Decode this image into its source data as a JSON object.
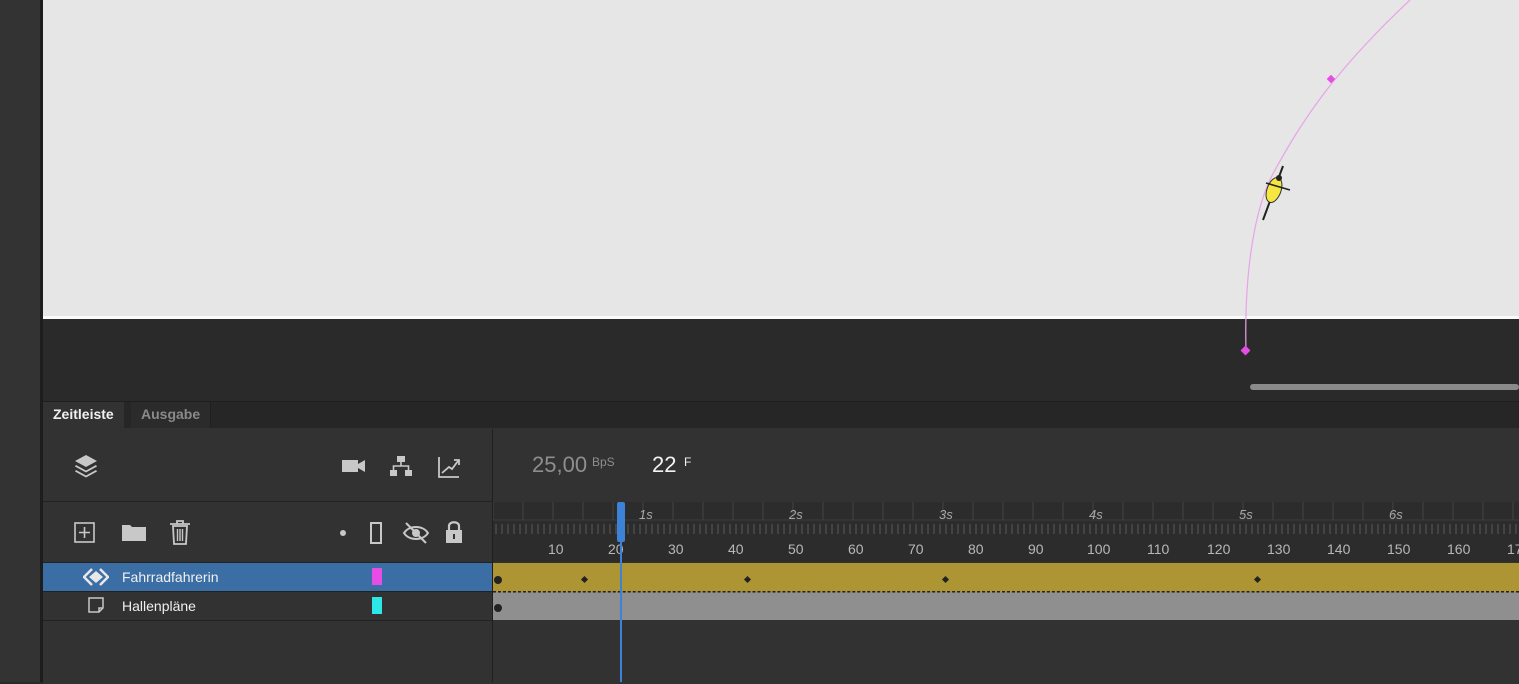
{
  "tabs": {
    "timeline": "Zeitleiste",
    "output": "Ausgabe"
  },
  "timeline": {
    "fps_value": "25,00",
    "fps_unit": "BpS",
    "current_frame": "22",
    "frame_unit": "F",
    "second_labels": [
      "1s",
      "2s",
      "3s",
      "4s",
      "5s",
      "6s"
    ],
    "frame_labels": [
      "10",
      "20",
      "30",
      "40",
      "50",
      "60",
      "70",
      "80",
      "90",
      "100",
      "110",
      "120",
      "130",
      "140",
      "150",
      "160",
      "17"
    ]
  },
  "layers": [
    {
      "name": "Fahrradfahrerin",
      "color": "#e64ce6",
      "selected": true,
      "icon": "motion-tween-icon"
    },
    {
      "name": "Hallenpläne",
      "color": "#2de6e6",
      "selected": false,
      "icon": "layer-icon"
    }
  ],
  "toolbar_icons": {
    "header": [
      "layers-icon",
      "camera-icon",
      "hierarchy-icon",
      "graph-icon"
    ],
    "tools": [
      "add-layer-icon",
      "folder-icon",
      "trash-icon",
      "dot-icon",
      "outline-icon",
      "hide-icon",
      "lock-icon"
    ]
  },
  "colors": {
    "accent": "#3c82d6",
    "tween": "#ad9534",
    "path": "#e64ce6"
  }
}
